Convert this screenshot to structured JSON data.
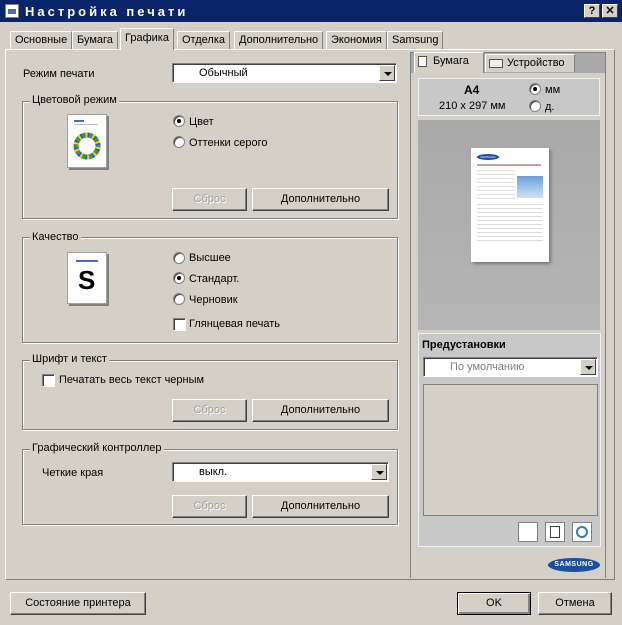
{
  "window": {
    "title": "Настройка печати",
    "help_btn": "?",
    "close_btn": "✕"
  },
  "tabs": [
    "Основные",
    "Бумага",
    "Графика",
    "Отделка",
    "Дополнительно",
    "Экономия",
    "Samsung"
  ],
  "print_mode": {
    "label": "Режим печати",
    "value": "Обычный"
  },
  "color_mode": {
    "legend": "Цветовой режим",
    "options": [
      "Цвет",
      "Оттенки серого"
    ],
    "selected": 0,
    "reset": "Сброс",
    "advanced": "Дополнительно"
  },
  "quality": {
    "legend": "Качество",
    "thumb_letter": "S",
    "options": [
      "Высшее",
      "Стандарт.",
      "Черновик"
    ],
    "selected": 1,
    "glossy_label": "Глянцевая печать",
    "glossy_checked": false
  },
  "font_text": {
    "legend": "Шрифт и текст",
    "all_black_label": "Печатать весь текст черным",
    "all_black_checked": false,
    "reset": "Сброс",
    "advanced": "Дополнительно"
  },
  "graphics_controller": {
    "legend": "Графический контроллер",
    "edge_label": "Четкие края",
    "edge_value": "выкл.",
    "reset": "Сброс",
    "advanced": "Дополнительно"
  },
  "right_panel": {
    "tabs": [
      "Бумага",
      "Устройство"
    ],
    "paper_name": "A4",
    "paper_size": "210 x 297 мм",
    "units": [
      "мм",
      "д."
    ],
    "units_selected": 0,
    "preview_logo": "SAMSUNG",
    "presets_title": "Предустановки",
    "presets_value": "По умолчанию",
    "brand": "SAMSUNG"
  },
  "footer": {
    "printer_status": "Состояние принтера",
    "ok": "OK",
    "cancel": "Отмена"
  },
  "colors": {
    "titlebar": "#0a246a",
    "face": "#d4d0c8",
    "samsung_blue": "#1d4fa0"
  }
}
